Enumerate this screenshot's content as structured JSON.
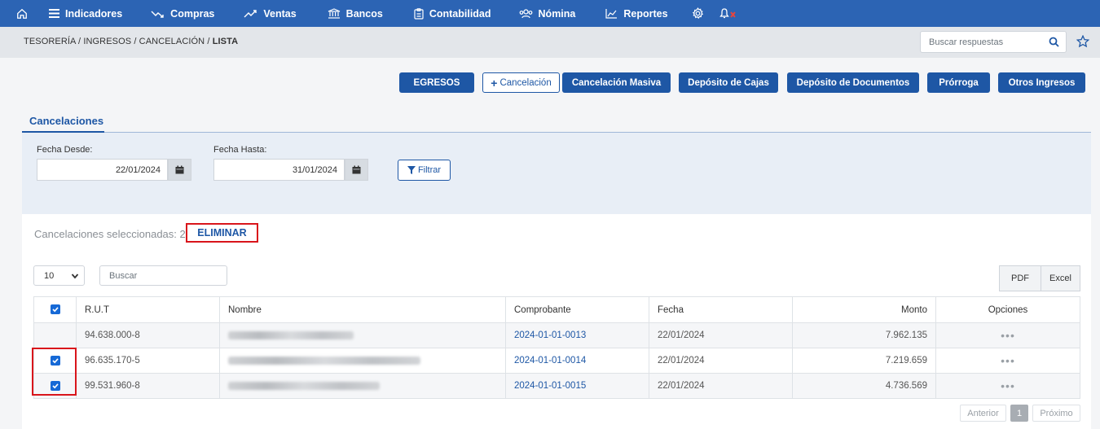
{
  "nav": {
    "items": [
      {
        "label": "Indicadores",
        "icon": "menu-icon"
      },
      {
        "label": "Compras",
        "icon": "trend-down-icon"
      },
      {
        "label": "Ventas",
        "icon": "trend-up-icon"
      },
      {
        "label": "Bancos",
        "icon": "bank-icon"
      },
      {
        "label": "Contabilidad",
        "icon": "clipboard-icon"
      },
      {
        "label": "Nómina",
        "icon": "users-icon"
      },
      {
        "label": "Reportes",
        "icon": "chart-icon"
      }
    ]
  },
  "breadcrumb": {
    "path": "TESORERÍA / INGRESOS / CANCELACIÓN / ",
    "current": "LISTA"
  },
  "search": {
    "placeholder": "Buscar respuestas"
  },
  "actions": {
    "egresos": "EGRESOS",
    "cancelacion": "Cancelación",
    "masiva": "Cancelación Masiva",
    "cajas": "Depósito de Cajas",
    "documentos": "Depósito de Documentos",
    "prorroga": "Prórroga",
    "otros": "Otros Ingresos"
  },
  "tab": {
    "label": "Cancelaciones"
  },
  "filter": {
    "desde_label": "Fecha Desde:",
    "desde_value": "22/01/2024",
    "hasta_label": "Fecha Hasta:",
    "hasta_value": "31/01/2024",
    "button": "Filtrar"
  },
  "selection": {
    "text": "Cancelaciones seleccionadas: 2",
    "delete": "ELIMINAR"
  },
  "table_controls": {
    "page_size": "10",
    "search_placeholder": "Buscar",
    "pdf": "PDF",
    "excel": "Excel"
  },
  "table": {
    "headers": {
      "rut": "R.U.T",
      "nombre": "Nombre",
      "comprobante": "Comprobante",
      "fecha": "Fecha",
      "monto": "Monto",
      "opciones": "Opciones"
    },
    "rows": [
      {
        "checked": false,
        "rut": "94.638.000-8",
        "comprobante": "2024-01-01-0013",
        "fecha": "22/01/2024",
        "monto": "7.962.135"
      },
      {
        "checked": true,
        "rut": "96.635.170-5",
        "comprobante": "2024-01-01-0014",
        "fecha": "22/01/2024",
        "monto": "7.219.659"
      },
      {
        "checked": true,
        "rut": "99.531.960-8",
        "comprobante": "2024-01-01-0015",
        "fecha": "22/01/2024",
        "monto": "4.736.569"
      }
    ]
  },
  "pagination": {
    "prev": "Anterior",
    "page": "1",
    "next": "Próximo"
  }
}
